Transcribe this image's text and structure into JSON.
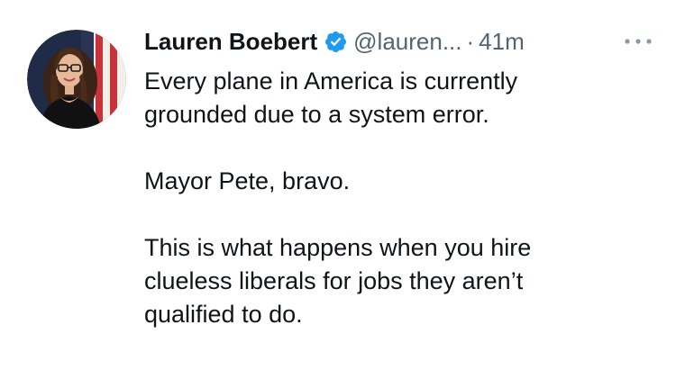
{
  "tweet": {
    "author": {
      "display_name": "Lauren Boebert",
      "verified": true,
      "verified_icon": "verified-badge-icon",
      "handle": "@lauren...",
      "separator": "·",
      "time": "41m"
    },
    "more_icon": "more-options-icon",
    "paragraphs": [
      [
        "Every plane in America is currently",
        "grounded due to a system error."
      ],
      [
        "Mayor Pete, bravo."
      ],
      [
        "This is what happens when you hire",
        "clueless liberals for jobs they aren’t",
        "qualified to do."
      ]
    ]
  },
  "colors": {
    "verified_blue": "#1d9bf0",
    "secondary_text": "#536471",
    "primary_text": "#0f1419"
  }
}
